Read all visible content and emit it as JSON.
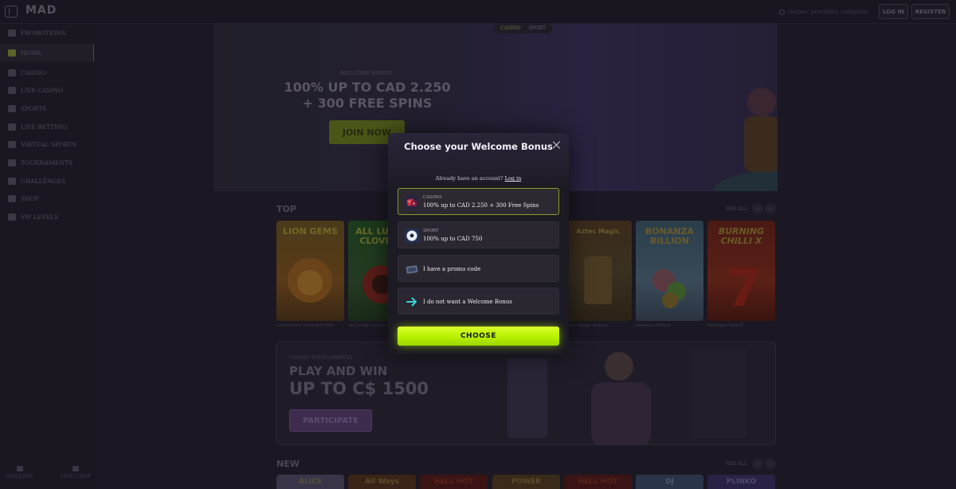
{
  "header": {
    "logo": "MAD",
    "search_placeholder": "Games, providers, categories",
    "login_label": "LOG IN",
    "register_label": "REGISTER"
  },
  "sidebar": {
    "items": [
      {
        "label": "PROMOTIONS",
        "icon": "gift-icon"
      },
      {
        "label": "HOME",
        "icon": "home-icon",
        "active": true
      },
      {
        "label": "CASINO",
        "icon": "casino-icon"
      },
      {
        "label": "LIVE CASINO",
        "icon": "live-casino-icon"
      },
      {
        "label": "SPORTS",
        "icon": "soccer-ball-icon"
      },
      {
        "label": "LIVE BETTING",
        "icon": "live-betting-icon"
      },
      {
        "label": "VIRTUAL SPORTS",
        "icon": "virtual-sports-icon"
      },
      {
        "label": "TOURNAMENTS",
        "icon": "trophy-icon"
      },
      {
        "label": "CHALLENGES",
        "icon": "target-icon"
      },
      {
        "label": "SHOP",
        "icon": "shop-icon"
      },
      {
        "label": "VIP LEVELS",
        "icon": "crown-icon"
      }
    ],
    "bottom": {
      "left": "ENGLISH",
      "right": "LIVE CHAT"
    }
  },
  "hero": {
    "tab_casino": "CASINO",
    "tab_sport": "SPORT",
    "kicker": "WELCOME BONUS",
    "title_line1": "100% UP TO CAD 2.250",
    "title_line2": "+ 300 FREE SPINS",
    "cta": "JOIN NOW"
  },
  "top_section": {
    "title": "TOP",
    "see_all": "SEE ALL",
    "games": [
      {
        "name": "Lion Gems: Hold and Win",
        "art": "LION GEMS"
      },
      {
        "name": "All Lucky Clovers 100",
        "art": "ALL LUCKY CLOVERS"
      },
      {
        "name": "Aztec Magic Deluxe",
        "art": "Aztec Magic"
      },
      {
        "name": "Bonanza Billion",
        "art": "BONANZA BILLION"
      },
      {
        "name": "Burning Chilli X",
        "art": "BURNING CHILLI X"
      }
    ]
  },
  "tournament_banner": {
    "kicker": "CASINO TOURNAMENTS",
    "line1": "PLAY AND WIN",
    "line2": "UP TO C$ 1500",
    "cta": "PARTICIPATE"
  },
  "new_section": {
    "title": "NEW",
    "see_all": "SEE ALL",
    "strip_labels": [
      "ALICE",
      "All Ways",
      "HELL HOT",
      "POWER",
      "HELL HOT",
      "DJ",
      "PLINKO"
    ]
  },
  "modal": {
    "title": "Choose your Welcome Bonus",
    "account_text": "Already have an account?",
    "login_link": "Log in",
    "options": [
      {
        "category": "CASINO",
        "text": "100% up to CAD 2.250 + 300 Free Spins",
        "icon": "dice-icon",
        "selected": true
      },
      {
        "category": "SPORT",
        "text": "100% up to CAD 750",
        "icon": "soccer-ball-icon",
        "selected": false
      },
      {
        "category": "",
        "text": "I have a promo code",
        "icon": "ticket-icon",
        "selected": false
      },
      {
        "category": "",
        "text": "I do not want a Welcome Bonus",
        "icon": "arrow-right-icon",
        "selected": false
      }
    ],
    "choose_label": "CHOOSE"
  },
  "colors": {
    "accent_lime": "#c4f20a",
    "selected_border": "#8c9a2b",
    "modal_bg": "#1c1a22",
    "overlay_bg": "#1b1823"
  }
}
